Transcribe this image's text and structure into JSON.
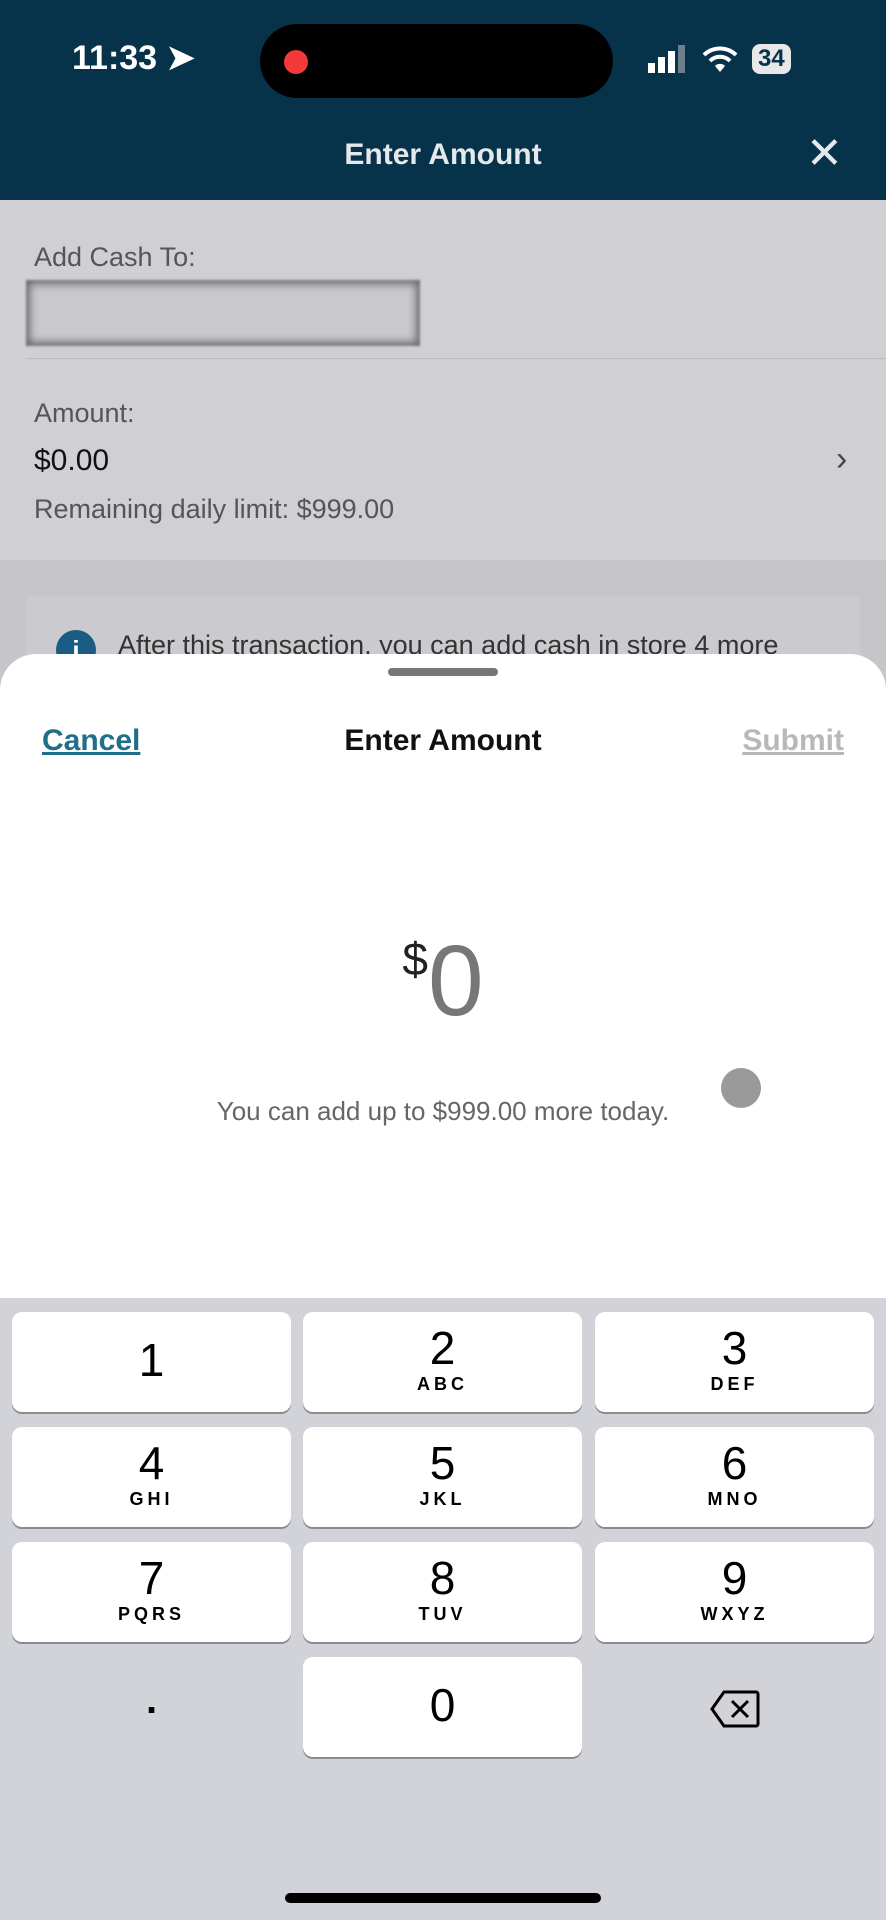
{
  "status_bar": {
    "time": "11:33",
    "battery": "34",
    "icons": [
      "location-arrow-icon",
      "recording-dot-icon",
      "signal-icon",
      "wifi-icon",
      "battery-icon"
    ]
  },
  "header": {
    "title": "Enter Amount",
    "close_icon": "close-icon"
  },
  "background": {
    "add_cash_label": "Add Cash To:",
    "amount_label": "Amount:",
    "amount_value": "$0.00",
    "remaining_limit": "Remaining daily limit: $999.00",
    "info_text": "After this transaction, you can add cash in store 4 more"
  },
  "sheet": {
    "cancel": "Cancel",
    "title": "Enter Amount",
    "submit": "Submit",
    "currency": "$",
    "amount": "0",
    "hint": "You can add up to $999.00 more today."
  },
  "keypad": {
    "keys": [
      {
        "n": "1",
        "l": ""
      },
      {
        "n": "2",
        "l": "ABC"
      },
      {
        "n": "3",
        "l": "DEF"
      },
      {
        "n": "4",
        "l": "GHI"
      },
      {
        "n": "5",
        "l": "JKL"
      },
      {
        "n": "6",
        "l": "MNO"
      },
      {
        "n": "7",
        "l": "PQRS"
      },
      {
        "n": "8",
        "l": "TUV"
      },
      {
        "n": "9",
        "l": "WXYZ"
      },
      {
        "n": "0",
        "l": ""
      }
    ],
    "decimal": ".",
    "delete_icon": "backspace-icon"
  },
  "colors": {
    "header": "#07334a",
    "link": "#1f6f8b",
    "disabled": "#b8b8b8",
    "info_icon": "#1a5c84"
  }
}
